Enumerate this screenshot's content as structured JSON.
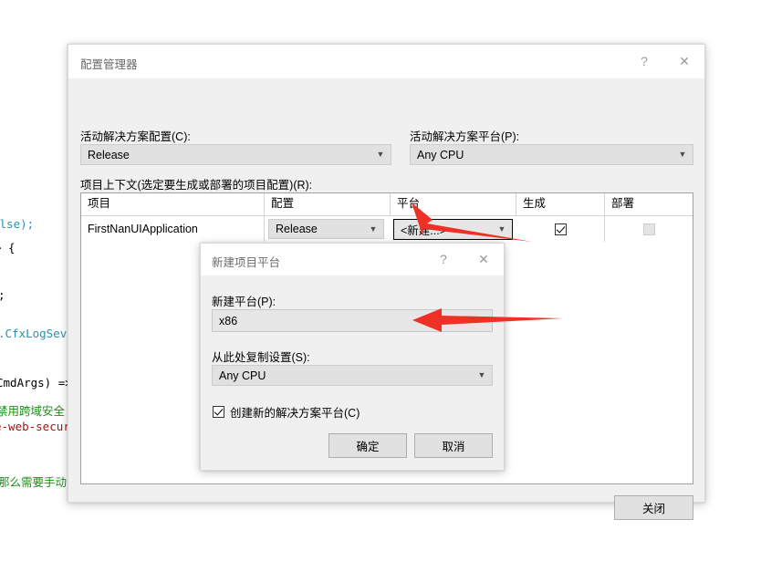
{
  "background_code": {
    "lines": [
      "alse);",
      "> {",
      ";",
      ".CfxLogSeve",
      "CmdArgs) =>",
      "禁用跨域安全",
      "e-web-secur",
      "那么需要手动"
    ]
  },
  "config_manager": {
    "title": "配置管理器",
    "help_icon": "?",
    "close_icon": "✕",
    "active_solution_config_label": "活动解决方案配置(C):",
    "active_solution_config_value": "Release",
    "active_solution_platform_label": "活动解决方案平台(P):",
    "active_solution_platform_value": "Any CPU",
    "project_contexts_label": "项目上下文(选定要生成或部署的项目配置)(R):",
    "columns": [
      "项目",
      "配置",
      "平台",
      "生成",
      "部署"
    ],
    "rows": [
      {
        "project": "FirstNanUIApplication",
        "configuration": "Release",
        "platform": "<新建...>",
        "build": true,
        "deploy": false
      }
    ],
    "close_button": "关闭"
  },
  "new_platform_dialog": {
    "title": "新建项目平台",
    "help_icon": "?",
    "close_icon": "✕",
    "new_platform_label": "新建平台(P):",
    "new_platform_value": "x86",
    "copy_settings_label": "从此处复制设置(S):",
    "copy_settings_value": "Any CPU",
    "create_solution_platform_label": "创建新的解决方案平台(C)",
    "create_solution_platform_checked": true,
    "ok_button": "确定",
    "cancel_button": "取消"
  },
  "annotations": {
    "arrow_color": "#ee3124",
    "arrow_1_target": "platform-cell-combo",
    "arrow_2_target": "new-platform-textbox"
  },
  "colors": {
    "dialog_bg": "#f0f0f0",
    "titlebar_bg": "#ffffff",
    "control_bg": "#e1e1e1",
    "grid_bg": "#ffffff",
    "arrow_red": "#ee3124"
  }
}
